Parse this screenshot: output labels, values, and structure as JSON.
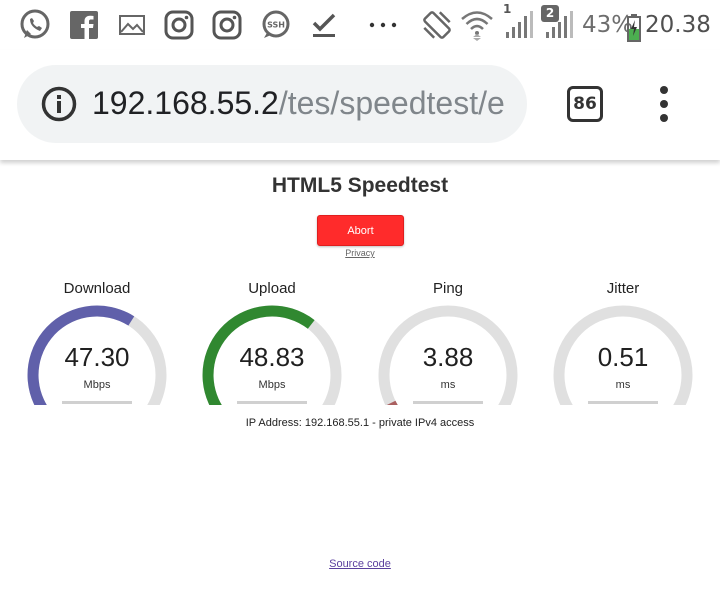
{
  "status_bar": {
    "battery": "43%",
    "time": "20.38",
    "signal1_badge": "1",
    "signal2_badge": "2",
    "icons": [
      "whatsapp-icon",
      "facebook-icon",
      "gallery-icon",
      "instagram-icon",
      "instagram-icon",
      "ssh-icon",
      "download-done-icon",
      "more-dots-icon",
      "vibrate-icon",
      "wifi-icon",
      "signal-icon",
      "signal-icon",
      "battery-charging-icon"
    ],
    "colors": {
      "battery_green": "#4caf50"
    }
  },
  "browser": {
    "url_host": "192.168.55.2",
    "url_path": "/tes/speedtest/e",
    "tab_count": "86"
  },
  "page": {
    "title": "HTML5 Speedtest",
    "abort_label": "Abort",
    "privacy_label": "Privacy",
    "ip_info": "IP Address: 192.168.55.1 - private IPv4 access",
    "source_label": "Source code",
    "gauges": [
      {
        "label": "Download",
        "value": "47.30",
        "unit": "Mbps",
        "fill": 0.62,
        "color": "#6060aa"
      },
      {
        "label": "Upload",
        "value": "48.83",
        "unit": "Mbps",
        "fill": 0.64,
        "color": "#308830"
      },
      {
        "label": "Ping",
        "value": "3.88",
        "unit": "ms",
        "fill": 0.07,
        "color": "#aa6060"
      },
      {
        "label": "Jitter",
        "value": "0.51",
        "unit": "ms",
        "fill": 0.03,
        "color": "#aa6060"
      }
    ],
    "colors": {
      "abort": "#ff2b2b",
      "track": "#e0e0e0",
      "link": "#5b3f9e"
    }
  }
}
